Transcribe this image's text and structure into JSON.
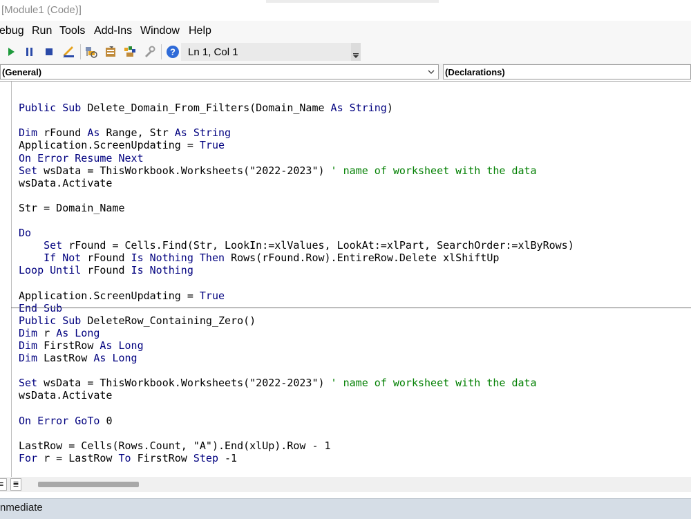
{
  "window": {
    "title": "[Module1 (Code)]"
  },
  "menu": {
    "items": [
      "ebug",
      "Run",
      "Tools",
      "Add-Ins",
      "Window",
      "Help"
    ]
  },
  "toolbar": {
    "icons": [
      "run-icon",
      "break-icon",
      "reset-icon",
      "design-mode-icon",
      "project-explorer-icon",
      "properties-icon",
      "object-browser-icon",
      "toolbox-icon",
      "help-icon"
    ],
    "position": "Ln 1, Col 1"
  },
  "combos": {
    "object": "(General)",
    "procedure": "(Declarations)"
  },
  "code": {
    "lines": [
      [],
      [
        [
          "k",
          "Public Sub "
        ],
        [
          "t",
          "Delete_Domain_From_Filters(Domain_Name "
        ],
        [
          "k",
          "As String"
        ],
        [
          "t",
          ")"
        ]
      ],
      [],
      [
        [
          "k",
          "Dim "
        ],
        [
          "t",
          "rFound "
        ],
        [
          "k",
          "As "
        ],
        [
          "t",
          "Range, Str "
        ],
        [
          "k",
          "As String"
        ]
      ],
      [
        [
          "t",
          "Application.ScreenUpdating = "
        ],
        [
          "k",
          "True"
        ]
      ],
      [
        [
          "k",
          "On Error Resume Next"
        ]
      ],
      [
        [
          "k",
          "Set "
        ],
        [
          "t",
          "wsData = ThisWorkbook.Worksheets(\"2022-2023\") "
        ],
        [
          "c",
          "' name of worksheet with the data"
        ]
      ],
      [
        [
          "t",
          "wsData.Activate"
        ]
      ],
      [],
      [
        [
          "t",
          "Str = Domain_Name"
        ]
      ],
      [],
      [
        [
          "k",
          "Do"
        ]
      ],
      [
        [
          "t",
          "    "
        ],
        [
          "k",
          "Set "
        ],
        [
          "t",
          "rFound = Cells.Find(Str, LookIn:=xlValues, LookAt:=xlPart, SearchOrder:=xlByRows)"
        ]
      ],
      [
        [
          "t",
          "    "
        ],
        [
          "k",
          "If Not "
        ],
        [
          "t",
          "rFound "
        ],
        [
          "k",
          "Is Nothing Then "
        ],
        [
          "t",
          "Rows(rFound.Row).EntireRow.Delete xlShiftUp"
        ]
      ],
      [
        [
          "k",
          "Loop Until "
        ],
        [
          "t",
          "rFound "
        ],
        [
          "k",
          "Is Nothing"
        ]
      ],
      [],
      [
        [
          "t",
          "Application.ScreenUpdating = "
        ],
        [
          "k",
          "True"
        ]
      ],
      [
        [
          "k",
          "End Sub"
        ]
      ],
      [
        [
          "k",
          "Public Sub "
        ],
        [
          "t",
          "DeleteRow_Containing_Zero()"
        ]
      ],
      [
        [
          "k",
          "Dim "
        ],
        [
          "t",
          "r "
        ],
        [
          "k",
          "As Long"
        ]
      ],
      [
        [
          "k",
          "Dim "
        ],
        [
          "t",
          "FirstRow "
        ],
        [
          "k",
          "As Long"
        ]
      ],
      [
        [
          "k",
          "Dim "
        ],
        [
          "t",
          "LastRow "
        ],
        [
          "k",
          "As Long"
        ]
      ],
      [],
      [
        [
          "k",
          "Set "
        ],
        [
          "t",
          "wsData = ThisWorkbook.Worksheets(\"2022-2023\") "
        ],
        [
          "c",
          "' name of worksheet with the data"
        ]
      ],
      [
        [
          "t",
          "wsData.Activate"
        ]
      ],
      [],
      [
        [
          "k",
          "On Error GoTo "
        ],
        [
          "t",
          "0"
        ]
      ],
      [],
      [
        [
          "t",
          "LastRow = Cells(Rows.Count, \"A\").End(xlUp).Row - 1"
        ]
      ],
      [
        [
          "k",
          "For "
        ],
        [
          "t",
          "r = LastRow "
        ],
        [
          "k",
          "To "
        ],
        [
          "t",
          "FirstRow "
        ],
        [
          "k",
          "Step "
        ],
        [
          "t",
          "-1"
        ]
      ]
    ]
  },
  "immediate": {
    "title": "nmediate"
  },
  "colors": {
    "keyword": "#00007f",
    "comment": "#007f00",
    "text": "#000000"
  }
}
